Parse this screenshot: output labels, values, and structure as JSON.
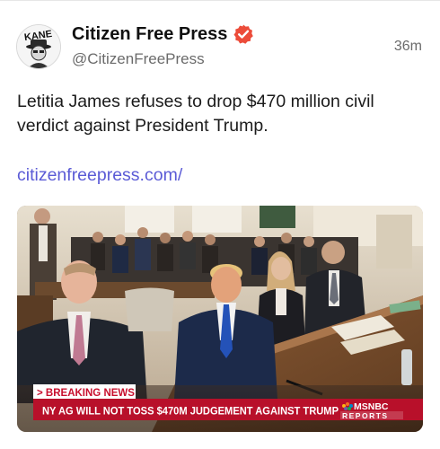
{
  "post": {
    "display_name": "Citizen Free Press",
    "handle": "@CitizenFreePress",
    "timestamp": "36m",
    "text": "Letitia James refuses to drop $470 million civil verdict against President Trump.",
    "link": "citizenfreepress.com/"
  },
  "avatar": {
    "logo_text": "KANE"
  },
  "media": {
    "breaking_label": "> BREAKING NEWS",
    "headline": "NY AG WILL NOT TOSS $470M JUDGEMENT AGAINST TRUMP",
    "network": "MSNBC",
    "network_sub": "REPORTS",
    "breaking_color": "#c8102e",
    "headline_bg": "#b8102a"
  },
  "colors": {
    "verified_badge": "#ec4c3a",
    "link": "#5b5bd6",
    "secondary_text": "#6b6b6b"
  },
  "icons": {
    "verified": "verified-badge-icon"
  }
}
